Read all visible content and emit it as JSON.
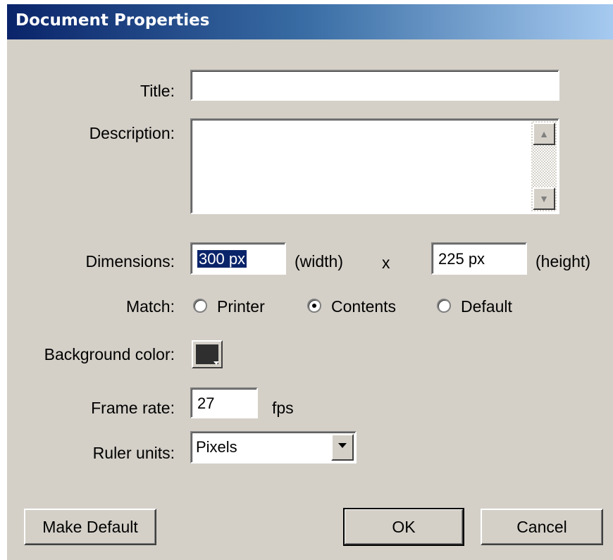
{
  "window": {
    "title": "Document Properties"
  },
  "title_field": {
    "label": "Title:",
    "value": ""
  },
  "description_field": {
    "label": "Description:",
    "value": ""
  },
  "dimensions": {
    "label": "Dimensions:",
    "width_value": "300 px",
    "width_suffix": "(width)",
    "times": "x",
    "height_value": "225 px",
    "height_suffix": "(height)"
  },
  "match": {
    "label": "Match:",
    "options": [
      {
        "label": "Printer",
        "selected": false
      },
      {
        "label": "Contents",
        "selected": true
      },
      {
        "label": "Default",
        "selected": false
      }
    ]
  },
  "background_color": {
    "label": "Background color:",
    "color": "#2f2f2f"
  },
  "frame_rate": {
    "label": "Frame rate:",
    "value": "27",
    "unit": "fps"
  },
  "ruler_units": {
    "label": "Ruler units:",
    "value": "Pixels"
  },
  "buttons": {
    "make_default": "Make Default",
    "ok": "OK",
    "cancel": "Cancel"
  },
  "icons": [
    "scroll-up-arrow-icon",
    "scroll-down-arrow-icon",
    "dropdown-arrow-icon",
    "color-picker-arrow-icon"
  ]
}
